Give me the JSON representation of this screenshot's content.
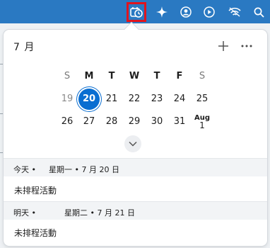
{
  "menubar": {
    "icons": [
      "calendar-clock-icon",
      "sparkle-icon",
      "user-circle-icon",
      "play-circle-icon",
      "wifi-icon",
      "search-icon"
    ]
  },
  "calendar": {
    "month_label": "7 月",
    "weekdays": [
      "S",
      "M",
      "T",
      "W",
      "T",
      "F",
      "S"
    ],
    "week1": [
      "19",
      "20",
      "21",
      "22",
      "23",
      "24",
      "25"
    ],
    "week2": [
      "26",
      "27",
      "28",
      "29",
      "30",
      "31"
    ],
    "next_month_label": "Aug",
    "next_month_day": "1",
    "today_day": "20"
  },
  "agenda": {
    "today": {
      "label": "今天 •",
      "date": "星期一 • 7 月 20 日",
      "event": "未排程活動"
    },
    "tomorrow": {
      "label": "明天 •",
      "date": "星期二 • 7 月 21 日",
      "event": "未排程活動"
    }
  },
  "colors": {
    "menubar": "#2a79c2",
    "accent": "#0a6ed1",
    "highlight": "#e0141e"
  }
}
